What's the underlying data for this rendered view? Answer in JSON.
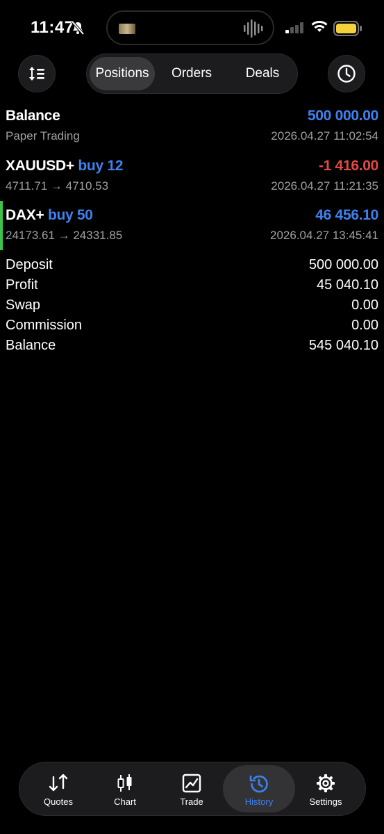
{
  "status": {
    "time": "11:47"
  },
  "segment": {
    "items": [
      "Positions",
      "Orders",
      "Deals"
    ],
    "active": "Positions"
  },
  "balance_row": {
    "title": "Balance",
    "amount": "500 000.00",
    "subtitle": "Paper Trading",
    "time": "2026.04.27 11:02:54"
  },
  "deals": [
    {
      "symbol": "XAUUSD+",
      "direction": "buy 12",
      "amount": "-1 416.00",
      "prices": "4711.71 → 4710.53",
      "time": "2026.04.27 11:21:35",
      "negative": true
    },
    {
      "symbol": "DAX+",
      "direction": "buy 50",
      "amount": "46 456.10",
      "prices": "24173.61 → 24331.85",
      "time": "2026.04.27 13:45:41",
      "negative": false
    }
  ],
  "summary": [
    {
      "label": "Deposit",
      "value": "500 000.00"
    },
    {
      "label": "Profit",
      "value": "45 040.10"
    },
    {
      "label": "Swap",
      "value": "0.00"
    },
    {
      "label": "Commission",
      "value": "0.00"
    },
    {
      "label": "Balance",
      "value": "545 040.10"
    }
  ],
  "tabs": [
    {
      "label": "Quotes",
      "icon": "quotes-icon"
    },
    {
      "label": "Chart",
      "icon": "candlestick-icon"
    },
    {
      "label": "Trade",
      "icon": "trade-icon"
    },
    {
      "label": "History",
      "icon": "history-icon",
      "active": true
    },
    {
      "label": "Settings",
      "icon": "gear-icon"
    }
  ],
  "colors": {
    "accent": "#3d82f0",
    "negative": "#e34a43",
    "position_marker": "#3cc34a",
    "background": "#000000"
  }
}
